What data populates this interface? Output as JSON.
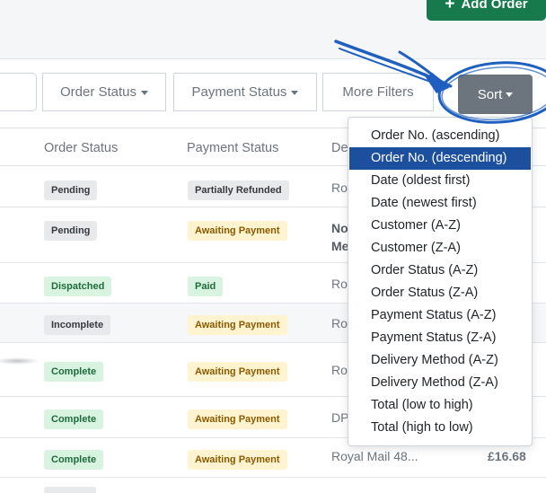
{
  "header": {
    "add_order_label": "Add Order"
  },
  "filters": {
    "order_status_label": "Order Status",
    "payment_status_label": "Payment Status",
    "more_filters_label": "More Filters",
    "sort_label": "Sort"
  },
  "table": {
    "headers": {
      "order_status": "Order Status",
      "payment_status": "Payment Status",
      "delivery": "De"
    },
    "rows": [
      {
        "order_status": "Pending",
        "payment_status": "Partially Refunded",
        "delivery": "Roy",
        "total": ""
      },
      {
        "order_status": "Pending",
        "payment_status": "Awaiting Payment",
        "delivery": "No",
        "delivery2": "Me",
        "total": ""
      },
      {
        "order_status": "Dispatched",
        "payment_status": "Paid",
        "delivery": "Roy",
        "total": ""
      },
      {
        "order_status": "Incomplete",
        "payment_status": "Awaiting Payment",
        "delivery": "Roy",
        "total": ""
      },
      {
        "order_status": "Complete",
        "payment_status": "Awaiting Payment",
        "delivery": "Roy",
        "total": ""
      },
      {
        "order_status": "Complete",
        "payment_status": "Awaiting Payment",
        "delivery": "DP",
        "total": ""
      },
      {
        "order_status": "Complete",
        "payment_status": "Awaiting Payment",
        "delivery": "Royal Mail 48...",
        "total": "£16.68"
      }
    ]
  },
  "sort_menu": {
    "items": [
      "Order No. (ascending)",
      "Order No. (descending)",
      "Date (oldest first)",
      "Date (newest first)",
      "Customer (A-Z)",
      "Customer (Z-A)",
      "Order Status (A-Z)",
      "Order Status (Z-A)",
      "Payment Status (A-Z)",
      "Payment Status (Z-A)",
      "Delivery Method (A-Z)",
      "Delivery Method (Z-A)",
      "Total (low to high)",
      "Total (high to low)"
    ],
    "selected_index": 1
  },
  "colors": {
    "add_order_bg": "#167a4c",
    "sort_button_bg": "#6c757d",
    "menu_active_bg": "#1c4f9e",
    "annotation_blue": "#1f5fbf"
  }
}
